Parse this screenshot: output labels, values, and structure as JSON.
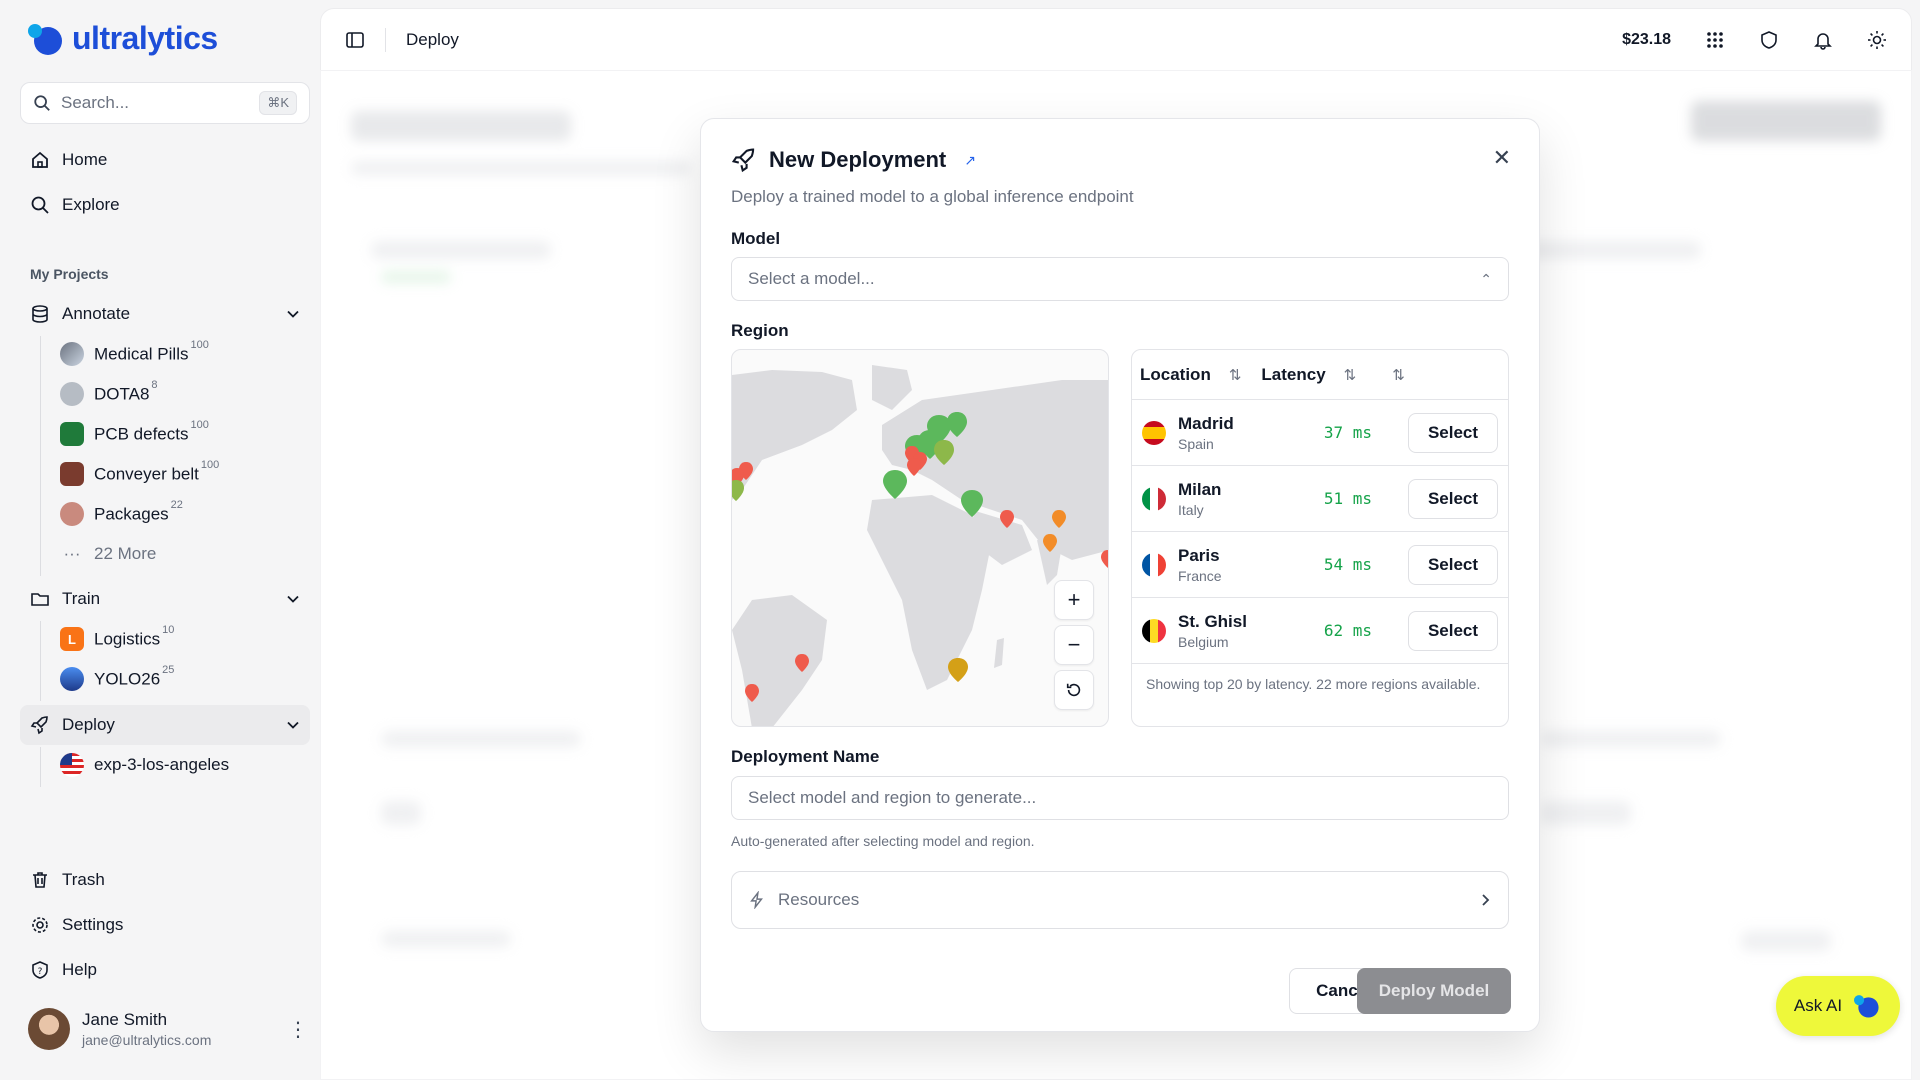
{
  "brand": {
    "name": "ultralytics"
  },
  "search": {
    "placeholder": "Search...",
    "shortcut": "⌘K"
  },
  "nav": {
    "home": "Home",
    "explore": "Explore",
    "trash": "Trash",
    "settings": "Settings",
    "help": "Help"
  },
  "projects": {
    "section_label": "My Projects",
    "annotate": {
      "label": "Annotate",
      "items": [
        {
          "name": "Medical Pills",
          "count": "100",
          "color": "#8f9aa8"
        },
        {
          "name": "DOTA8",
          "count": "8",
          "color": "#b6bcc4"
        },
        {
          "name": "PCB defects",
          "count": "100",
          "color": "#1f7a3a"
        },
        {
          "name": "Conveyer belt",
          "count": "100",
          "color": "#7a3b2e"
        },
        {
          "name": "Packages",
          "count": "22",
          "color": "#c98a7e"
        }
      ],
      "more": "22 More"
    },
    "train": {
      "label": "Train",
      "items": [
        {
          "name": "Logistics",
          "count": "10",
          "color": "#f97316",
          "letter": "L"
        },
        {
          "name": "YOLO26",
          "count": "25",
          "color": "#2b5cc7"
        }
      ]
    },
    "deploy": {
      "label": "Deploy",
      "items": [
        {
          "name": "exp-3-los-angeles"
        }
      ]
    }
  },
  "user": {
    "name": "Jane Smith",
    "email": "jane@ultralytics.com"
  },
  "topbar": {
    "breadcrumb": "Deploy",
    "balance": "$23.18"
  },
  "modal": {
    "title": "New Deployment",
    "subtitle": "Deploy a trained model to a global inference endpoint",
    "model_label": "Model",
    "model_placeholder": "Select a model...",
    "region_label": "Region",
    "table": {
      "col_location": "Location",
      "col_latency": "Latency",
      "rows": [
        {
          "city": "Madrid",
          "country": "Spain",
          "latency": "37",
          "unit": "ms",
          "select": "Select"
        },
        {
          "city": "Milan",
          "country": "Italy",
          "latency": "51",
          "unit": "ms",
          "select": "Select"
        },
        {
          "city": "Paris",
          "country": "France",
          "latency": "54",
          "unit": "ms",
          "select": "Select"
        },
        {
          "city": "St. Ghisl",
          "country": "Belgium",
          "latency": "62",
          "unit": "ms",
          "select": "Select"
        }
      ],
      "footer": "Showing top 20 by latency. 22 more regions available."
    },
    "name_label": "Deployment Name",
    "name_placeholder": "Select model and region to generate...",
    "name_hint": "Auto-generated after selecting model and region.",
    "resources_label": "Resources",
    "cancel": "Cancel",
    "deploy": "Deploy Model"
  },
  "ask_ai": "Ask AI",
  "colors": {
    "accent": "#1d4ed8",
    "latency_green": "#16a34a",
    "ask_ai_bg": "#eef83a",
    "deploy_btn": "#8c8d91"
  }
}
